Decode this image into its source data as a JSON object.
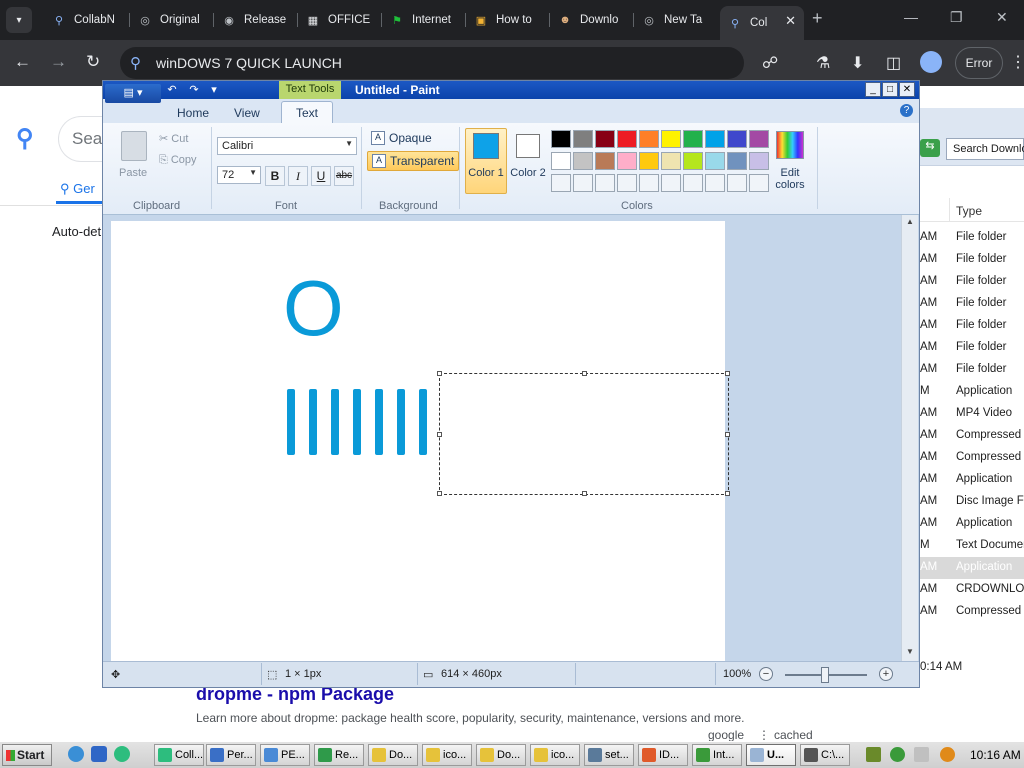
{
  "browser": {
    "tabs": [
      {
        "label": "CollabN",
        "icon": "search-icon"
      },
      {
        "label": "Original",
        "icon": "globe-icon"
      },
      {
        "label": "Release",
        "icon": "github-icon"
      },
      {
        "label": "OFFICE",
        "icon": "building-icon"
      },
      {
        "label": "Internet",
        "icon": "flag-icon"
      },
      {
        "label": "How to",
        "icon": "doc-icon"
      },
      {
        "label": "Downlo",
        "icon": "download-site-icon"
      },
      {
        "label": "New Ta",
        "icon": "globe-icon"
      },
      {
        "label": "Col",
        "icon": "search-icon"
      }
    ],
    "address": "winDOWS 7 QUICK LAUNCH",
    "error_label": "Error"
  },
  "page": {
    "search_placeholder": "Sea",
    "tab_label": "Ger",
    "auto_detect": "Auto-det",
    "result_title": "dropme - npm Package",
    "result_desc": "Learn more about dropme: package health score, popularity, security, maintenance, versions and more.",
    "link_google": "google",
    "link_cached": "cached"
  },
  "explorer": {
    "search_placeholder": "Search Downlo",
    "header_type": "Type",
    "rows": [
      {
        "time": "AM",
        "type": "File folder"
      },
      {
        "time": "AM",
        "type": "File folder"
      },
      {
        "time": "AM",
        "type": "File folder"
      },
      {
        "time": "AM",
        "type": "File folder"
      },
      {
        "time": "AM",
        "type": "File folder"
      },
      {
        "time": "AM",
        "type": "File folder"
      },
      {
        "time": "AM",
        "type": "File folder"
      },
      {
        "time": "M",
        "type": "Application"
      },
      {
        "time": "AM",
        "type": "MP4 Video"
      },
      {
        "time": "AM",
        "type": "Compressed (z"
      },
      {
        "time": "AM",
        "type": "Compressed (z"
      },
      {
        "time": "AM",
        "type": "Application"
      },
      {
        "time": "AM",
        "type": "Disc Image File"
      },
      {
        "time": "AM",
        "type": "Application"
      },
      {
        "time": "M",
        "type": "Text Document"
      },
      {
        "time": "AM",
        "type": "Application"
      },
      {
        "time": "AM",
        "type": "CRDOWNLOAD"
      },
      {
        "time": "AM",
        "type": "Compressed (z"
      }
    ],
    "bottom_time": "0:14 AM"
  },
  "paint": {
    "context_tab": "Text Tools",
    "title": "Untitled - Paint",
    "tabs": {
      "home": "Home",
      "view": "View",
      "text": "Text"
    },
    "clipboard": {
      "paste": "Paste",
      "cut": "Cut",
      "copy": "Copy",
      "group": "Clipboard"
    },
    "font": {
      "name": "Calibri",
      "size": "72",
      "bold": "B",
      "italic": "I",
      "underline": "U",
      "strike": "abc",
      "group": "Font"
    },
    "background": {
      "opaque": "Opaque",
      "transparent": "Transparent",
      "group": "Background"
    },
    "colors": {
      "color1_label": "Color 1",
      "color2_label": "Color 2",
      "edit_label": "Edit colors",
      "group": "Colors",
      "color1": "#0ea2e8",
      "color2": "#ffffff",
      "palette_row1": [
        "#000000",
        "#7f7f7f",
        "#880015",
        "#ed1c24",
        "#ff7f27",
        "#fff200",
        "#22b14c",
        "#00a2e8",
        "#3f48cc",
        "#a349a4"
      ],
      "palette_row2": [
        "#ffffff",
        "#c3c3c3",
        "#b97a57",
        "#ffaec9",
        "#ffc90e",
        "#efe4b0",
        "#b5e61d",
        "#99d9ea",
        "#7092be",
        "#c8bfe7"
      ],
      "palette_row3": [
        "#f0f4f9",
        "#f0f4f9",
        "#f0f4f9",
        "#f0f4f9",
        "#f0f4f9",
        "#f0f4f9",
        "#f0f4f9",
        "#f0f4f9",
        "#f0f4f9",
        "#f0f4f9"
      ]
    },
    "canvas": {
      "letter": "O",
      "ink": "#0a9ad8"
    },
    "status": {
      "selection": "1 × 1px",
      "size": "614 × 460px",
      "zoom": "100%"
    }
  },
  "taskbar": {
    "start": "Start",
    "items": [
      "Coll...",
      "Per...",
      "PE...",
      "Re...",
      "Do...",
      "ico...",
      "Do...",
      "ico...",
      "set...",
      "ID...",
      "Int...",
      "U...",
      "C:\\..."
    ],
    "clock": "10:16 AM"
  }
}
